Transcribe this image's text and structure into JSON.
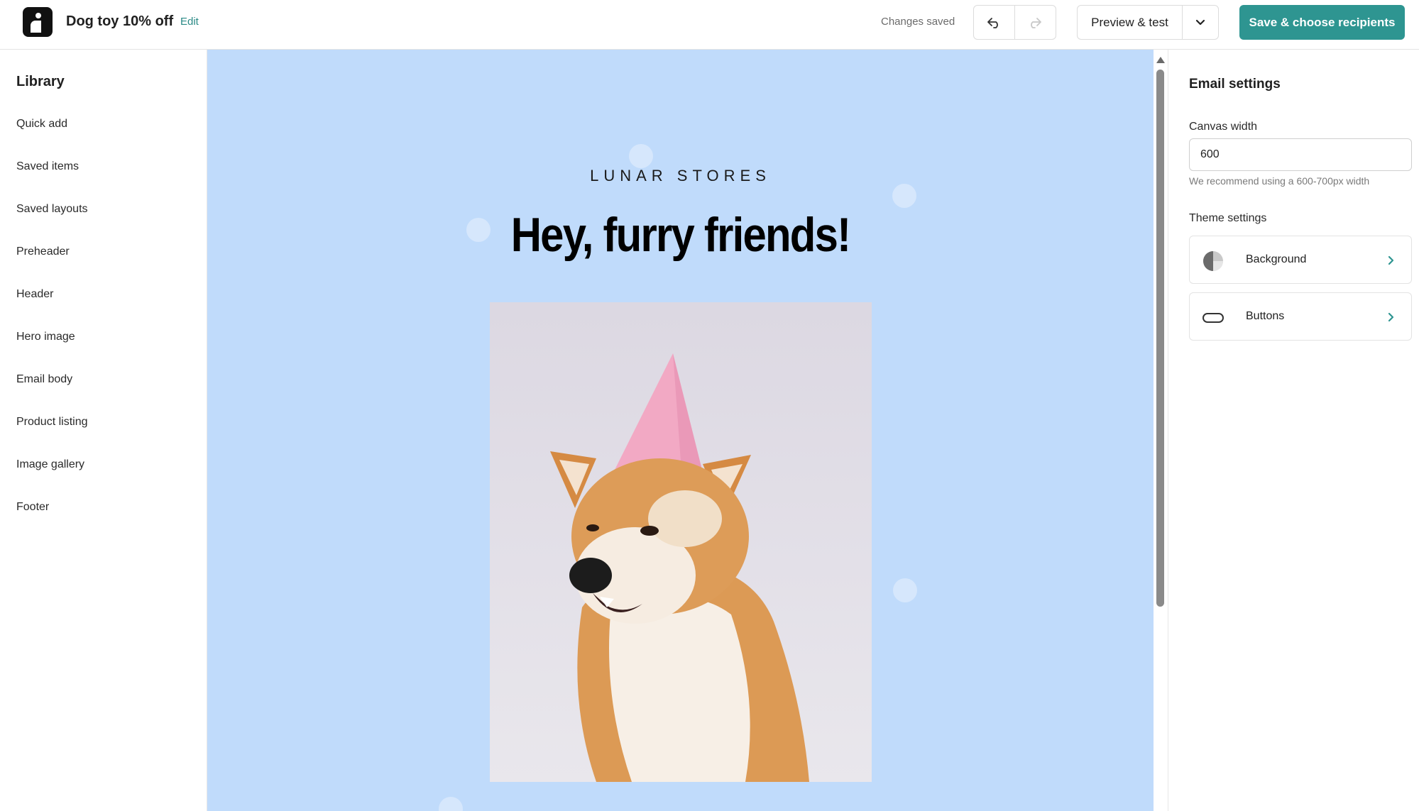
{
  "app": {
    "logo_icon": "brand-logo-icon",
    "document_title": "Dog toy 10% off",
    "edit_label": "Edit",
    "status_text": "Changes saved",
    "undo_icon": "undo-icon",
    "redo_icon": "redo-icon",
    "preview_label": "Preview & test",
    "preview_dropdown_icon": "chevron-down-icon",
    "save_label": "Save & choose recipients",
    "accent_color": "#2e9591"
  },
  "sidebar": {
    "title": "Library",
    "items": [
      {
        "label": "Quick add"
      },
      {
        "label": "Saved items"
      },
      {
        "label": "Saved layouts"
      },
      {
        "label": "Preheader"
      },
      {
        "label": "Header"
      },
      {
        "label": "Hero image"
      },
      {
        "label": "Email body"
      },
      {
        "label": "Product listing"
      },
      {
        "label": "Image gallery"
      },
      {
        "label": "Footer"
      }
    ]
  },
  "canvas": {
    "background_color": "#c0dbfb",
    "brand_name": "LUNAR STORES",
    "headline": "Hey, furry friends!",
    "hero_image": "shiba-inu-dog-party-hat-photo"
  },
  "settings": {
    "title": "Email settings",
    "canvas_width_label": "Canvas width",
    "canvas_width_value": "600",
    "canvas_width_hint": "We recommend using a 600-700px width",
    "theme_settings_label": "Theme settings",
    "theme_items": [
      {
        "label": "Background",
        "icon": "background-half-circle-icon"
      },
      {
        "label": "Buttons",
        "icon": "button-pill-icon"
      }
    ]
  }
}
